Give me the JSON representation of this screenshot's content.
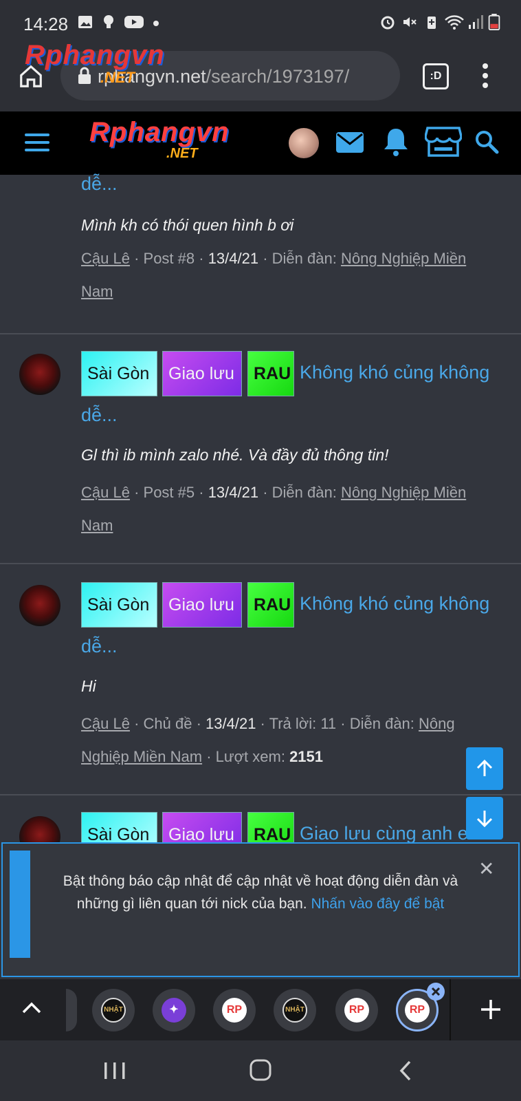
{
  "status_bar": {
    "time": "14:28",
    "icons_left": [
      "image-icon",
      "bulb-icon",
      "youtube-icon",
      "dot-icon"
    ],
    "icons_right": [
      "alarm-icon",
      "mute-icon",
      "battery-saver-icon",
      "wifi-icon",
      "signal-icon",
      "battery-icon"
    ]
  },
  "browser": {
    "url_domain": "rphangvn.net",
    "url_path": "/search/1973197/",
    "tab_switcher_label": ":D",
    "logo_text": "Rphangvn",
    "logo_sub": ".NET"
  },
  "forum_header": {
    "logo_text": "Rphangvn",
    "logo_sub": ".NET"
  },
  "posts": [
    {
      "title_tail": "dễ...",
      "snippet": "Mình kh có thói quen hình b ơi",
      "author": "Cậu Lê",
      "post_label": "Post #8",
      "date": "13/4/21",
      "forum_prefix": "Diễn đàn:",
      "forum_line1": "Nông Nghiệp Miền",
      "forum_line2": "Nam"
    },
    {
      "tags": [
        "Sài Gòn",
        "Giao lưu",
        "RAU"
      ],
      "title_line1": "Không khó củng không",
      "title_line2": "dễ...",
      "snippet": "Gl thì ib mình zalo nhé. Và đầy đủ thông tin!",
      "author": "Cậu Lê",
      "post_label": "Post #5",
      "date": "13/4/21",
      "forum_prefix": "Diễn đàn:",
      "forum_line1": "Nông Nghiệp Miền",
      "forum_line2": "Nam"
    },
    {
      "tags": [
        "Sài Gòn",
        "Giao lưu",
        "RAU"
      ],
      "title_line1": "Không khó củng không",
      "title_line2": "dễ...",
      "snippet": "Hi",
      "author": "Cậu Lê",
      "kind": "Chủ đề",
      "date": "13/4/21",
      "replies_label": "Trả lời: 11",
      "forum_prefix": "Diễn đàn:",
      "forum_line1": "Nông",
      "forum_line2": "Nghiệp Miền Nam",
      "views_label": "Lượt xem:",
      "views": "2151"
    },
    {
      "tags": [
        "Sài Gòn",
        "Giao lưu",
        "RAU"
      ],
      "title_line1": "Giao lưu cùng anh em..."
    }
  ],
  "notice": {
    "text": "Bật thông báo cập nhật để cập nhật về hoạt động diễn đàn và những gì liên quan tới nick của bạn.",
    "link": "Nhấn vào đây để bật",
    "close": "✕"
  },
  "tab_strip": {
    "tabs": [
      {
        "label": "NHẬT"
      },
      {
        "label": "✦"
      },
      {
        "label": "RP"
      },
      {
        "label": "NHẬT"
      },
      {
        "label": "RP"
      },
      {
        "label": "RP"
      }
    ],
    "active_index": 5
  },
  "colors": {
    "accent": "#2196e9",
    "link": "#4aa8e8",
    "background": "#32353d",
    "tag_saigon": "#2ef2f2",
    "tag_giaoluu": "#a23ceb",
    "tag_rau": "#2ef128"
  }
}
